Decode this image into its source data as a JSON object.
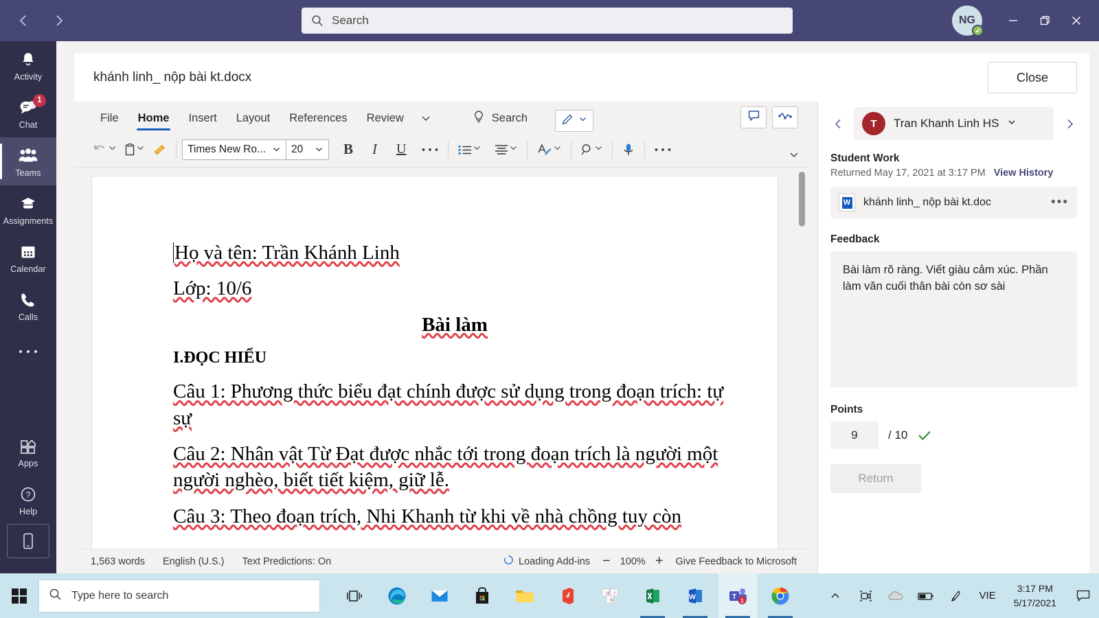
{
  "titlebar": {
    "back_icon": "chevron-left-icon",
    "forward_icon": "chevron-right-icon",
    "search_placeholder": "Search",
    "avatar_initials": "NG",
    "minimize_label": "—",
    "maximize_label": "❐",
    "close_label": "✕"
  },
  "rail": {
    "items": [
      {
        "label": "Activity",
        "icon": "bell-icon"
      },
      {
        "label": "Chat",
        "icon": "chat-icon",
        "badge": "1"
      },
      {
        "label": "Teams",
        "icon": "people-icon",
        "active": true
      },
      {
        "label": "Assignments",
        "icon": "assignments-icon"
      },
      {
        "label": "Calendar",
        "icon": "calendar-icon"
      },
      {
        "label": "Calls",
        "icon": "phone-icon"
      },
      {
        "label": "",
        "icon": "more-dots-icon"
      }
    ],
    "bottom": [
      {
        "label": "Apps",
        "icon": "apps-icon"
      },
      {
        "label": "Help",
        "icon": "help-icon"
      }
    ],
    "phone_icon": "mobile-device-icon"
  },
  "doc_header": {
    "title": "khánh linh_ nộp bài kt.docx",
    "close_label": "Close"
  },
  "word": {
    "tabs": [
      {
        "label": "File"
      },
      {
        "label": "Home",
        "active": true
      },
      {
        "label": "Insert"
      },
      {
        "label": "Layout"
      },
      {
        "label": "References"
      },
      {
        "label": "Review"
      }
    ],
    "tabs_overflow_icon": "chevron-down-icon",
    "tell_me": {
      "label": "Search",
      "icon": "lightbulb-icon"
    },
    "editing_mode": {
      "icon": "pencil-icon",
      "chevron": "chevron-down-icon"
    },
    "comments_icon": "comment-icon",
    "activity_icon": "activity-graph-icon",
    "ribbon": {
      "undo": "undo-icon",
      "paste": "paste-icon",
      "format_painter": "format-painter-icon",
      "font_name": "Times New Ro...",
      "font_size": "20",
      "bold": "B",
      "italic": "I",
      "underline": "U",
      "more_font": "more-dots-icon",
      "bullets": "bullets-icon",
      "align": "align-icon",
      "styles": "styles-icon",
      "find": "find-icon",
      "dictate": "microphone-icon",
      "more": "more-dots-icon",
      "collapse": "chevron-down-icon"
    },
    "document": {
      "lines": [
        {
          "text": "Họ và tên: Trần Khánh Linh",
          "style": "normal",
          "caret": true
        },
        {
          "text": "Lớp: 10/6",
          "style": "normal"
        },
        {
          "text": "Bài làm",
          "style": "center"
        },
        {
          "text": "I.ĐỌC HIỂU",
          "style": "bold"
        },
        {
          "text": "Câu 1: Phương thức biểu đạt chính được sử dụng trong đoạn trích: tự sự",
          "style": "wrap"
        },
        {
          "text": "Câu 2: Nhân vật Từ Đạt được nhắc tới trong đoạn trích là người một người nghèo, biết tiết kiệm, giữ lễ.",
          "style": "wrap"
        },
        {
          "text": "Câu 3: Theo đoạn trích, Nhi Khanh từ khi về nhà chồng tuy còn",
          "style": "wrap"
        }
      ]
    },
    "status": {
      "word_count": "1,563 words",
      "language": "English (U.S.)",
      "predictions": "Text Predictions: On",
      "addins": "Loading Add-ins",
      "zoom_out": "−",
      "zoom_level": "100%",
      "zoom_in": "+",
      "feedback": "Give Feedback to Microsoft"
    }
  },
  "panel": {
    "prev_icon": "chevron-left-icon",
    "next_icon": "chevron-right-icon",
    "student": {
      "initials": "T",
      "name": "Tran Khanh Linh HS",
      "chevron": "chevron-down-icon"
    },
    "student_work_label": "Student Work",
    "returned_text": "Returned May 17, 2021 at 3:17 PM",
    "view_history_label": "View History",
    "attachment": {
      "name": "khánh linh_ nộp bài kt.doc",
      "icon": "word-file-icon",
      "menu": "•••"
    },
    "feedback_label": "Feedback",
    "feedback_text": "Bài làm rõ ràng. Viết giàu cảm xúc. Phần làm văn cuối thân bài còn sơ sài",
    "points_label": "Points",
    "points_value": "9",
    "points_total": "/ 10",
    "points_check_icon": "checkmark-icon",
    "return_label": "Return"
  },
  "taskbar": {
    "start_icon": "windows-start-icon",
    "search_placeholder": "Type here to search",
    "search_icon": "search-icon",
    "apps": [
      {
        "name": "task-view-icon"
      },
      {
        "name": "edge-icon"
      },
      {
        "name": "mail-icon"
      },
      {
        "name": "microsoft-store-icon"
      },
      {
        "name": "file-explorer-icon"
      },
      {
        "name": "office-icon"
      },
      {
        "name": "sticky-notes-icon"
      },
      {
        "name": "excel-icon"
      },
      {
        "name": "word-icon"
      },
      {
        "name": "teams-icon"
      },
      {
        "name": "chrome-icon"
      }
    ],
    "tray": {
      "show_hidden_icon": "chevron-up-icon",
      "meet_now_icon": "meet-now-icon",
      "onedrive_icon": "onedrive-icon",
      "battery_icon": "battery-icon",
      "pen_icon": "pen-icon",
      "language": "VIE",
      "time": "3:17 PM",
      "date": "5/17/2021",
      "action_center_icon": "action-center-icon"
    }
  },
  "colors": {
    "teams_purple": "#464775",
    "rail_dark": "#2f2f4a",
    "word_blue": "#185abd",
    "badge_red": "#c4314b",
    "presence_green": "#92c353",
    "check_green": "#107c10",
    "taskbar_blue": "#cbe5ef"
  }
}
